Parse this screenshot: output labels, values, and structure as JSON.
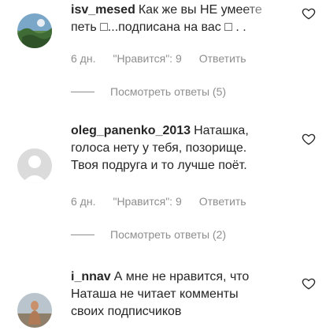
{
  "comments": [
    {
      "username": "isv_mesed",
      "text_line1": "Как же вы НЕ умеете",
      "text_line2": "петь □...подписана на вас □ . .",
      "time": "6 дн.",
      "likes": "\"Нравится\": 9",
      "reply_label": "Ответить",
      "view_replies": "Посмотреть ответы (5)"
    },
    {
      "username": "oleg_panenko_2013",
      "text_line1": "Наташка,",
      "text_line2": "голоса нету у тебя, позорище.",
      "text_line3": "Твоя подруга и то лучше поёт.",
      "time": "6 дн.",
      "likes": "\"Нравится\": 9",
      "reply_label": "Ответить",
      "view_replies": "Посмотреть ответы (2)"
    },
    {
      "username": "i_nnav",
      "text_line1": "А мне не нравится, что",
      "text_line2": "Наташа не читает комменты",
      "text_line3": "своих подписчиков"
    }
  ],
  "icons": {
    "like": "heart-outline-icon",
    "default_avatar": "default-avatar-icon"
  },
  "colors": {
    "text": "#262626",
    "secondary": "#8e8e8e",
    "avatar_placeholder": "#dbdbdb"
  }
}
